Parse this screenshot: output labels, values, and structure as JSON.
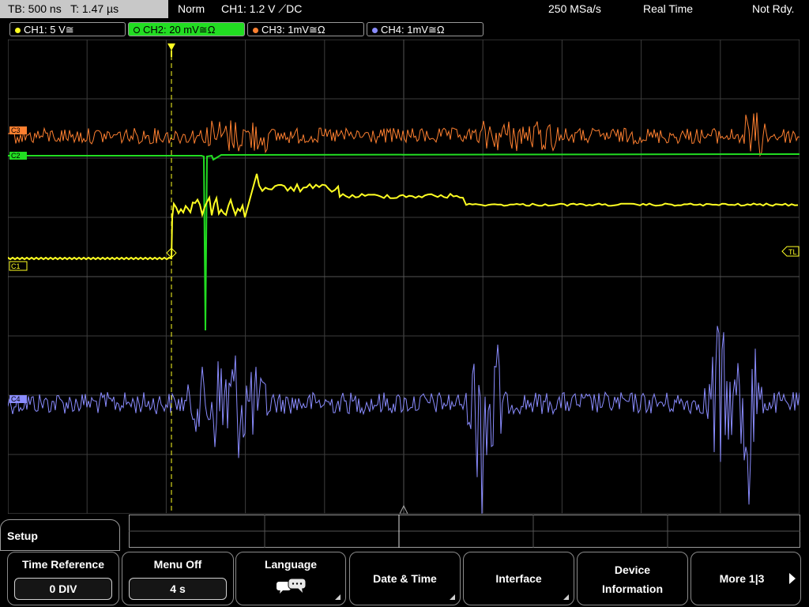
{
  "status_bar": {
    "timebase": "TB: 500 ns   T: 1.47 µs",
    "mode": "Norm",
    "trigger": "CH1: 1.2 V ⟋DC",
    "sample_rate": "250 MSa/s",
    "acq_mode": "Real Time",
    "state": "Not Rdy."
  },
  "channels": [
    {
      "label": "CH1: 5 V≅",
      "color": "#ffff22"
    },
    {
      "label": "CH2: 20 mV≅Ω",
      "color": "#22dd22",
      "active": true
    },
    {
      "label": "CH3: 1mV≅Ω",
      "color": "#ff8030"
    },
    {
      "label": "CH4: 1mV≅Ω",
      "color": "#8a8cff"
    }
  ],
  "scope": {
    "trigger_level_marker": "TL",
    "ch1_marker": "C1",
    "ch3_marker": "C3",
    "ch2_marker": "C2",
    "ch4_marker": "C4"
  },
  "menu": {
    "title": "Setup",
    "softkeys": [
      {
        "label": "Time Reference",
        "value": "0 DIV"
      },
      {
        "label": "Menu Off",
        "value": "4 s"
      },
      {
        "label": "Language",
        "icon": "speech-bubble-icon"
      },
      {
        "label": "Date & Time"
      },
      {
        "label": "Interface"
      },
      {
        "label1": "Device",
        "label2": "Information"
      },
      {
        "label": "More 1|3"
      }
    ]
  }
}
